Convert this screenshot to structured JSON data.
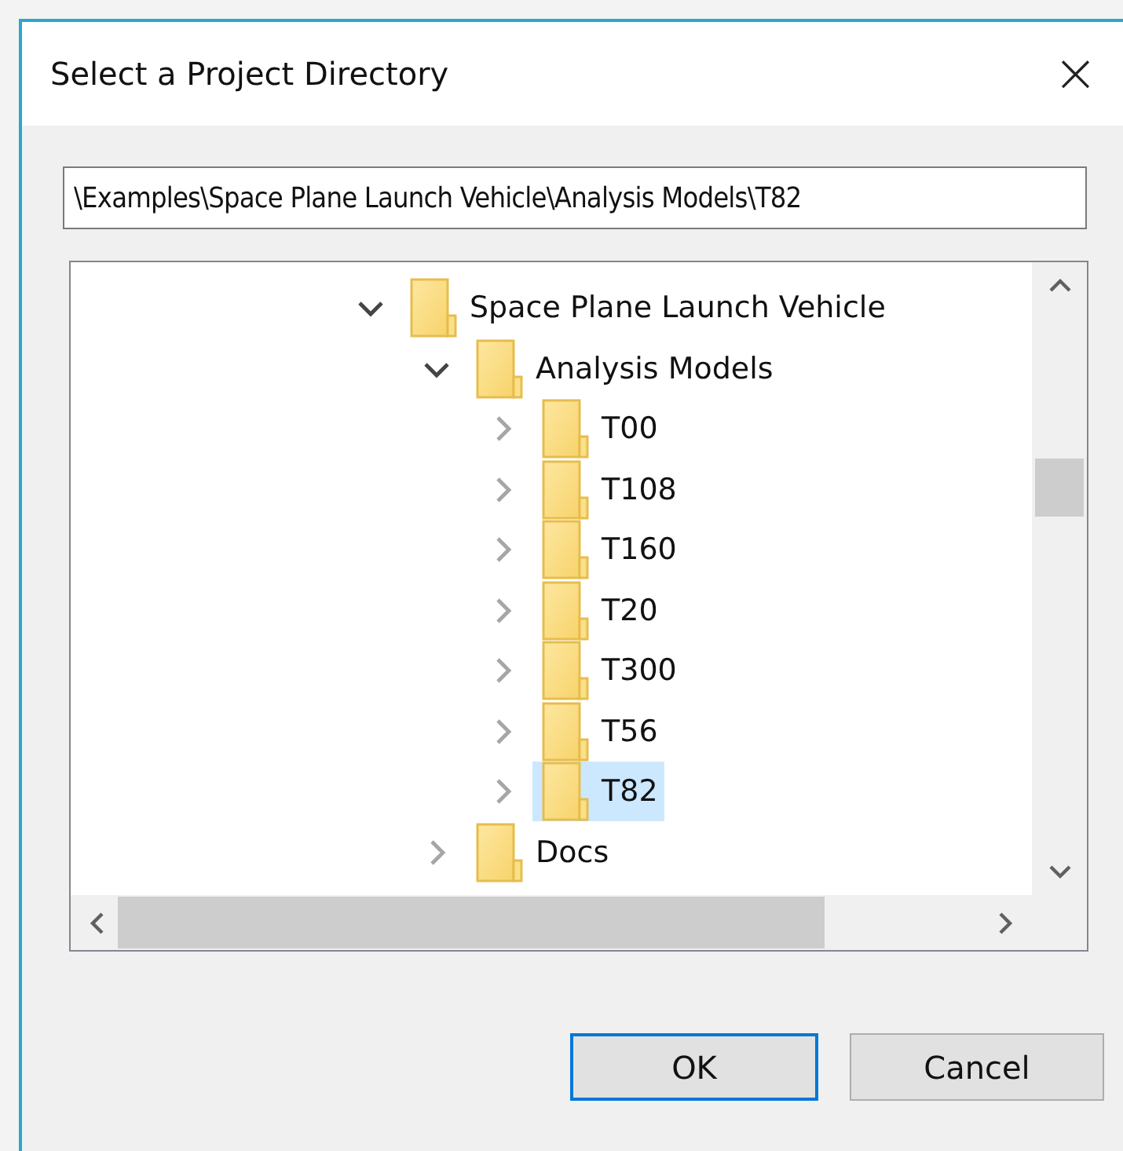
{
  "window": {
    "title": "Select a Project Directory",
    "close": "×"
  },
  "path_field": {
    "value": "\\Examples\\Space Plane Launch Vehicle\\Analysis Models\\T82"
  },
  "tree": [
    {
      "label": "Space Plane Launch Vehicle",
      "expanded": true,
      "selected": false,
      "children": [
        {
          "label": "Analysis Models",
          "expanded": true,
          "selected": false,
          "children": [
            {
              "label": "T00",
              "expanded": false,
              "selected": false
            },
            {
              "label": "T108",
              "expanded": false,
              "selected": false
            },
            {
              "label": "T160",
              "expanded": false,
              "selected": false
            },
            {
              "label": "T20",
              "expanded": false,
              "selected": false
            },
            {
              "label": "T300",
              "expanded": false,
              "selected": false
            },
            {
              "label": "T56",
              "expanded": false,
              "selected": false
            },
            {
              "label": "T82",
              "expanded": false,
              "selected": true
            }
          ]
        },
        {
          "label": "Docs",
          "expanded": false,
          "selected": false
        }
      ]
    }
  ],
  "buttons": [
    {
      "label": "OK",
      "default": true
    },
    {
      "label": "Cancel",
      "default": false
    }
  ]
}
